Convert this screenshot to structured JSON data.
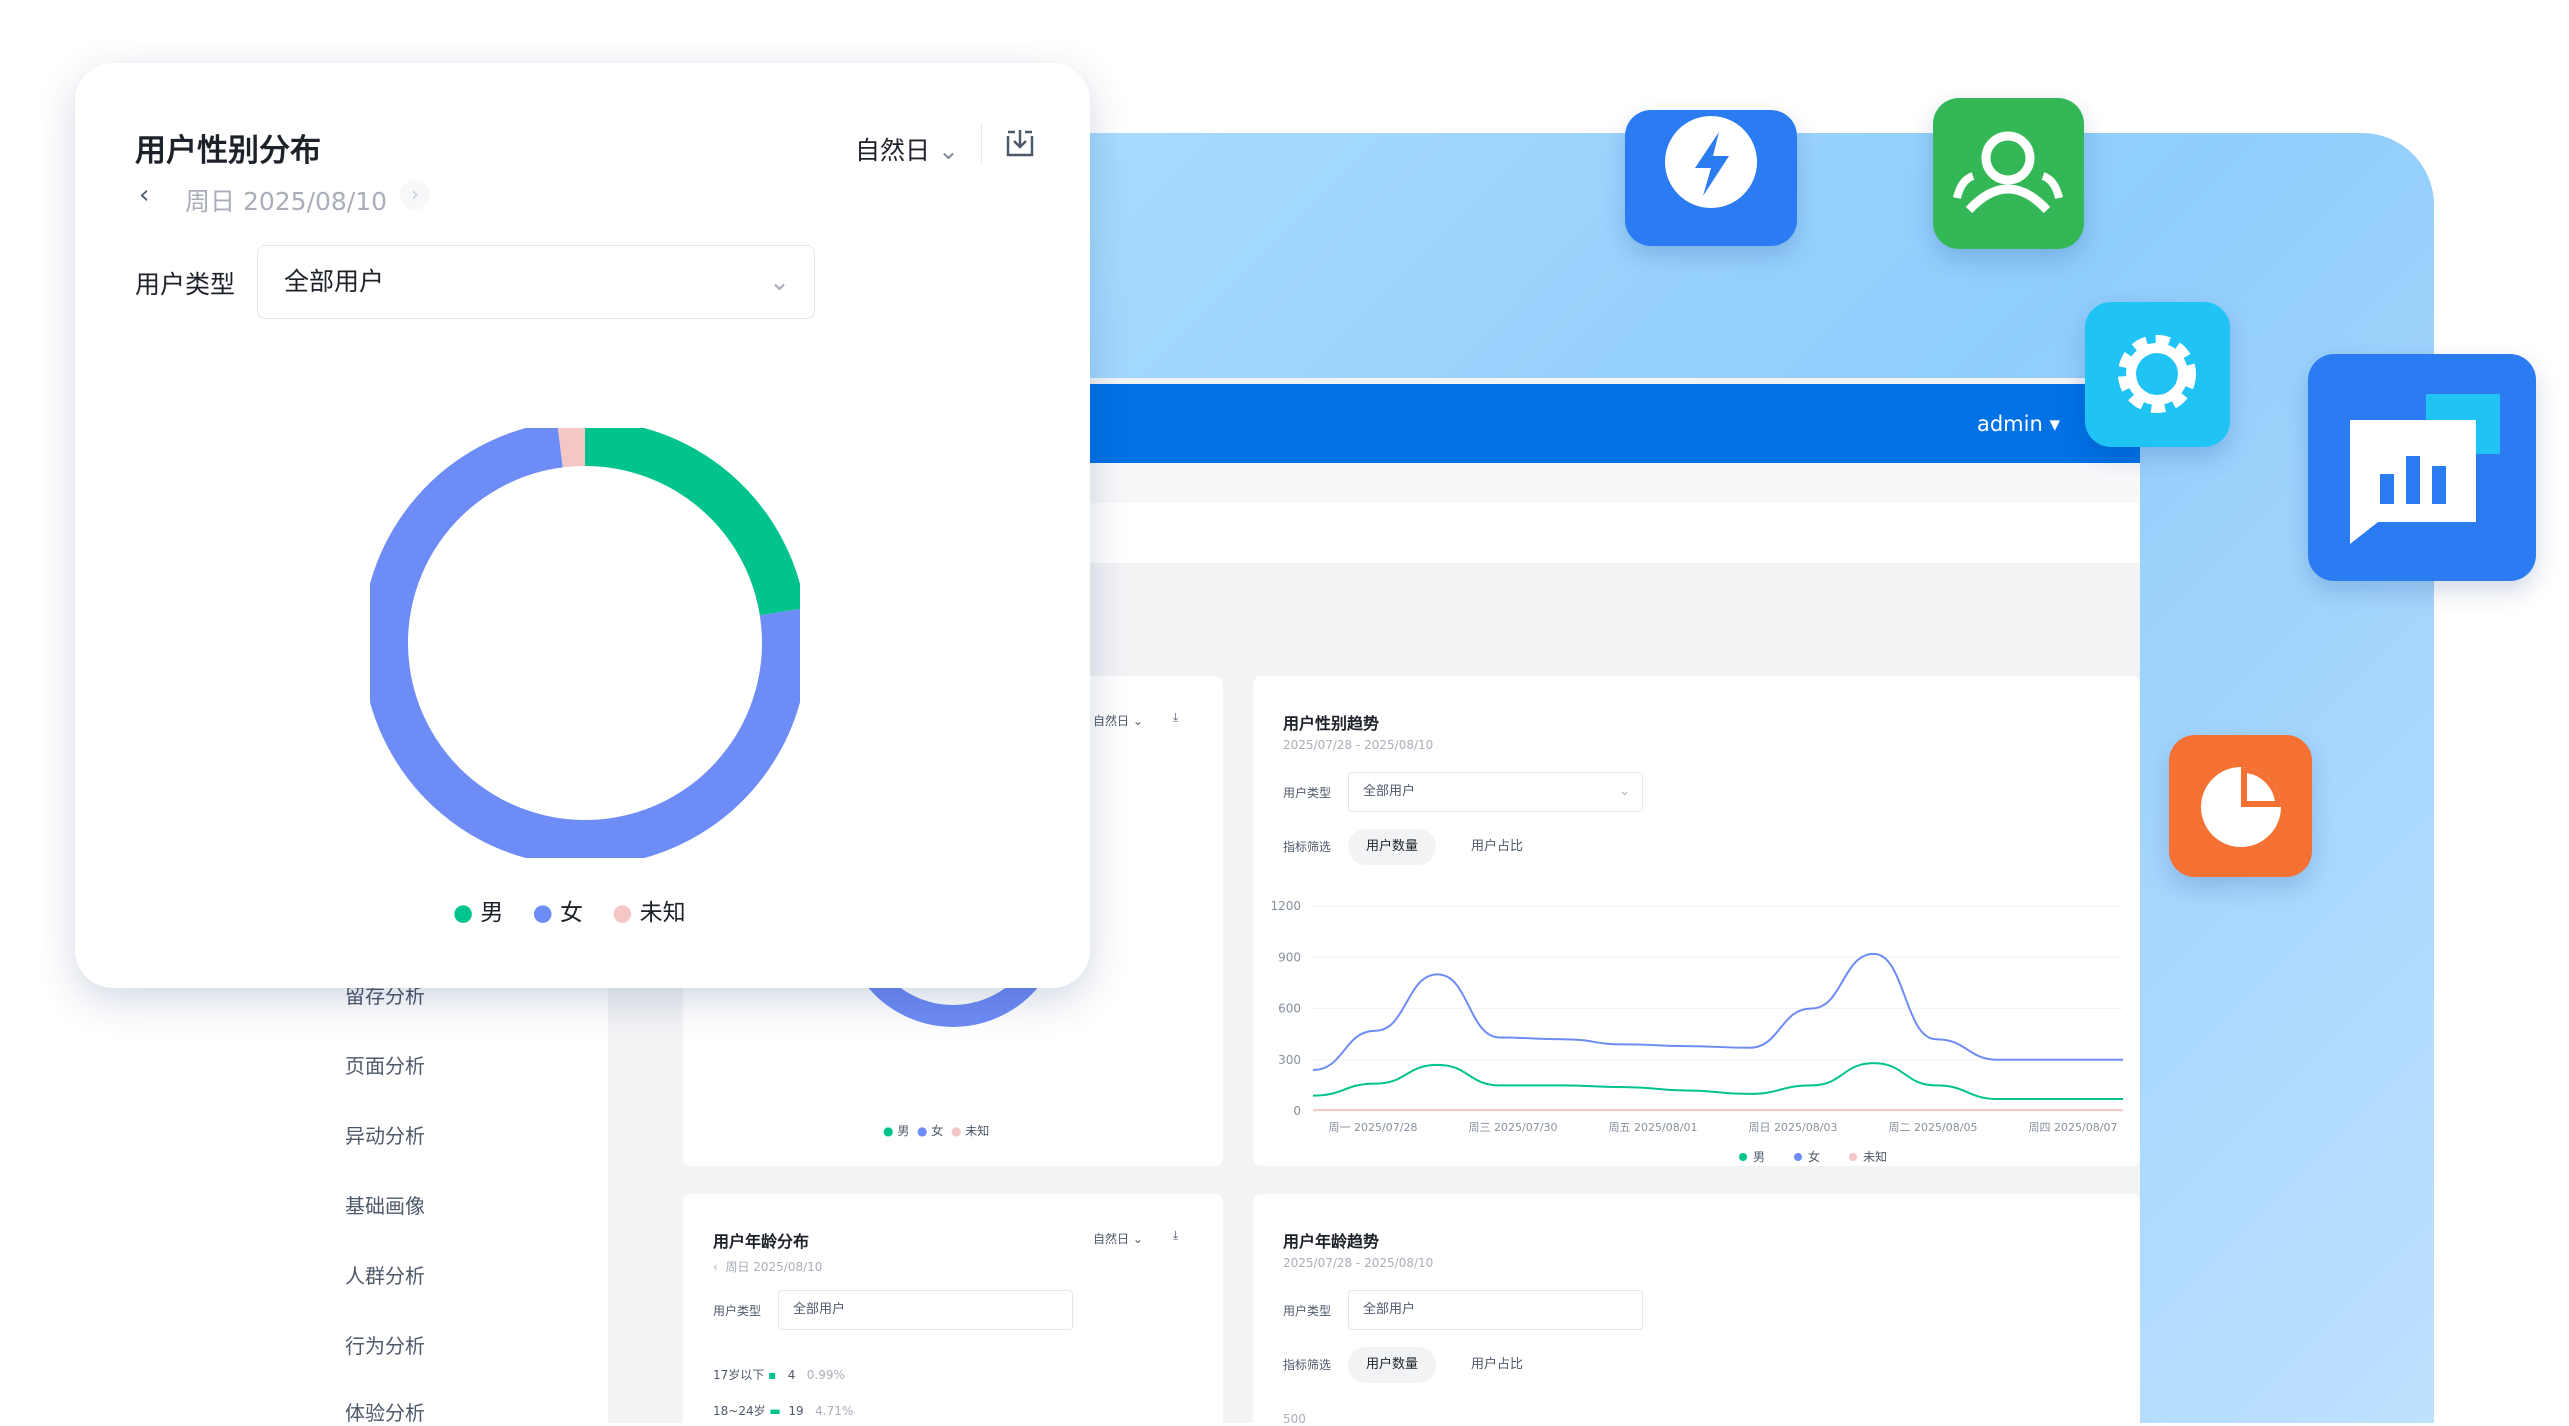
{
  "popup": {
    "title": "用户性别分布",
    "period": "自然日",
    "date": "周日 2025/08/10",
    "filter_label": "用户类型",
    "filter_value": "全部用户",
    "legend": [
      "男",
      "女",
      "未知"
    ]
  },
  "chart_data": {
    "type": "pie",
    "donut": true,
    "title": "用户性别分布",
    "categories": [
      "男",
      "女",
      "未知"
    ],
    "values": [
      22.5,
      75.5,
      2.0
    ],
    "colors": [
      "#00c48c",
      "#6e8cf5",
      "#f5c6c6"
    ]
  },
  "header": {
    "user": "admin"
  },
  "sidebar": {
    "items": [
      "留存分析",
      "页面分析",
      "异动分析",
      "基础画像",
      "人群分析",
      "行为分析",
      "体验分析"
    ]
  },
  "trend": {
    "title": "用户性别趋势",
    "range": "2025/07/28 - 2025/08/10",
    "filter_label": "用户类型",
    "filter_value": "全部用户",
    "metric_label": "指标筛选",
    "metric_tabs": [
      "用户数量",
      "用户占比"
    ],
    "legend": [
      "男",
      "女",
      "未知"
    ],
    "y_ticks": [
      "1200",
      "900",
      "600",
      "300",
      "0"
    ],
    "x_ticks": [
      "周一 2025/07/28",
      "周三 2025/07/30",
      "周五 2025/08/01",
      "周日 2025/08/03",
      "周二 2025/08/05",
      "周四 2025/08/07"
    ]
  },
  "gender_small": {
    "period": "自然日",
    "legend": [
      "男",
      "女",
      "未知"
    ]
  },
  "age": {
    "title": "用户年龄分布",
    "period": "自然日",
    "date": "周日 2025/08/10",
    "filter_label": "用户类型",
    "filter_value": "全部用户",
    "rows": [
      {
        "label": "17岁以下",
        "value": "4",
        "pct": "0.99%"
      },
      {
        "label": "18~24岁",
        "value": "19",
        "pct": "4.71%"
      }
    ]
  },
  "age_trend": {
    "title": "用户年龄趋势",
    "range": "2025/07/28 - 2025/08/10",
    "filter_label": "用户类型",
    "filter_value": "全部用户",
    "metric_label": "指标筛选",
    "metric_tabs": [
      "用户数量",
      "用户占比"
    ],
    "y_top": "500"
  },
  "trend_chart_data": {
    "type": "line",
    "x": [
      "2025/07/28",
      "2025/07/29",
      "2025/07/30",
      "2025/07/31",
      "2025/08/01",
      "2025/08/02",
      "2025/08/03",
      "2025/08/04",
      "2025/08/05",
      "2025/08/06",
      "2025/08/07",
      "2025/08/08",
      "2025/08/09",
      "2025/08/10"
    ],
    "series": [
      {
        "name": "男",
        "values": [
          90,
          160,
          270,
          150,
          150,
          140,
          120,
          100,
          150,
          280,
          150,
          70,
          70,
          70
        ]
      },
      {
        "name": "女",
        "values": [
          240,
          470,
          800,
          430,
          420,
          390,
          380,
          370,
          600,
          920,
          420,
          300,
          300,
          300
        ]
      },
      {
        "name": "未知",
        "values": [
          5,
          5,
          5,
          5,
          5,
          5,
          5,
          5,
          5,
          5,
          5,
          5,
          5,
          5
        ]
      }
    ],
    "ylim": [
      0,
      1200
    ]
  }
}
